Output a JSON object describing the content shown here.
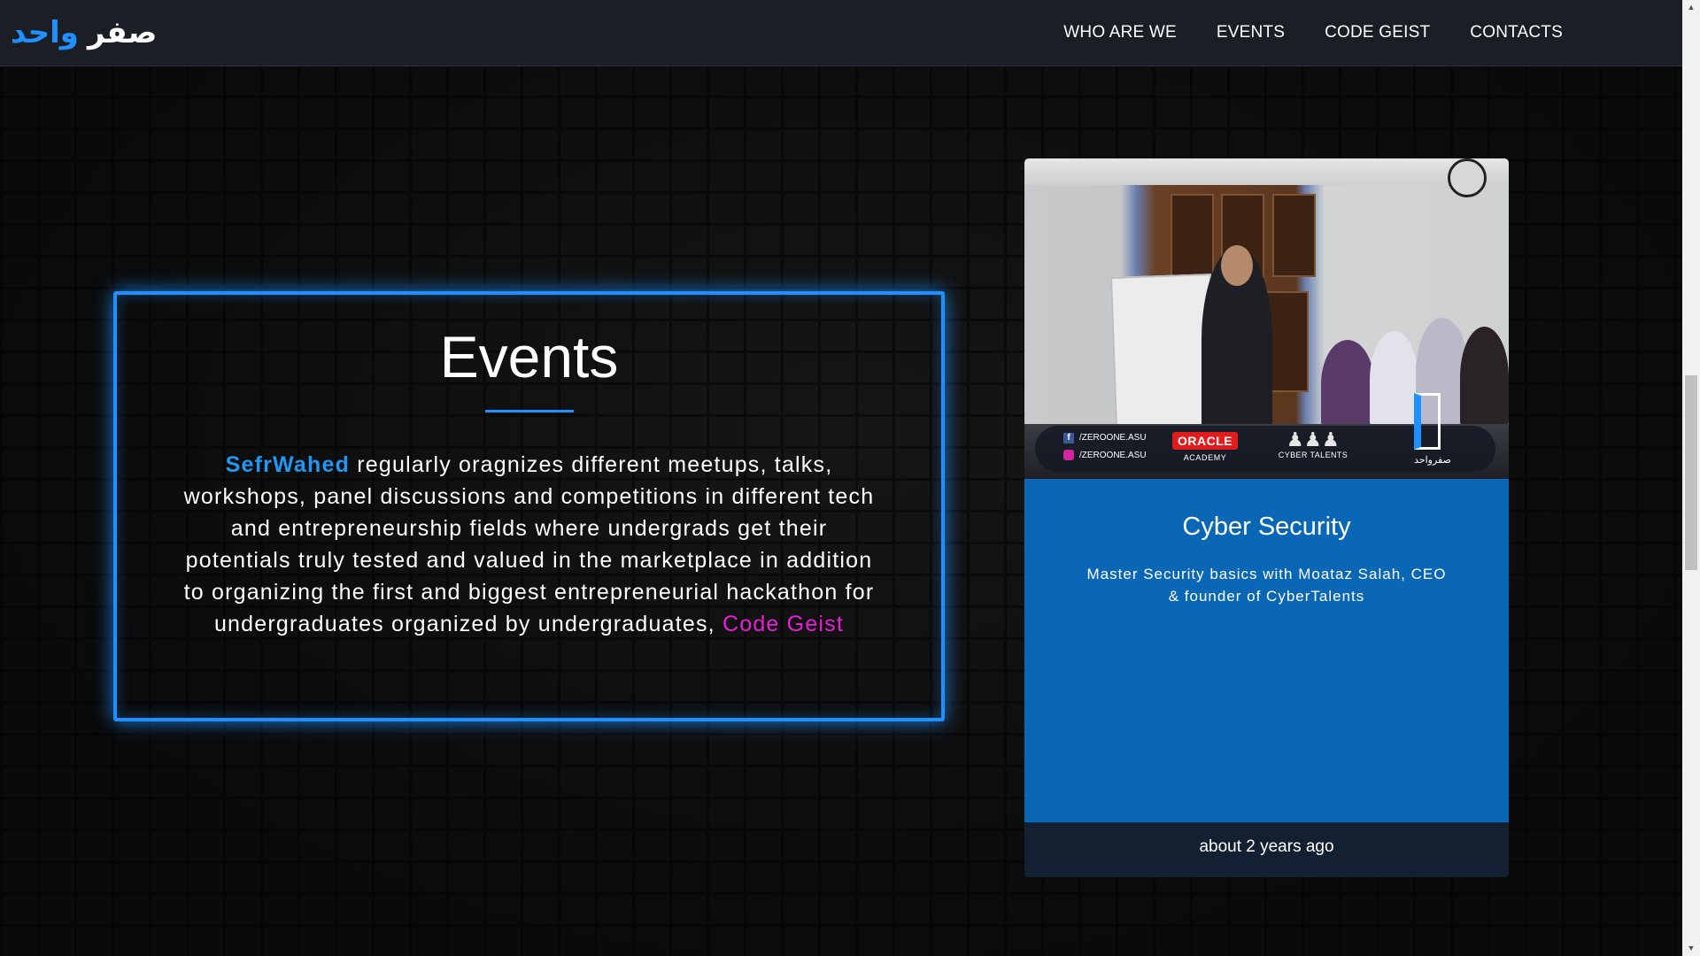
{
  "brand": {
    "word1": "صفر",
    "word2": "واحد"
  },
  "nav": {
    "items": [
      {
        "label": "WHO ARE WE"
      },
      {
        "label": "EVENTS"
      },
      {
        "label": "CODE GEIST"
      },
      {
        "label": "CONTACTS"
      }
    ]
  },
  "events": {
    "title": "Events",
    "org_name": "SefrWahed",
    "description": "regularly oragnizes different meetups, talks, workshops, panel discussions and competitions in different tech and entrepreneurship fields where undergrads get their potentials truly tested and valued in the marketplace in addition to organizing the first and biggest entrepreneurial hackathon for undergraduates organized by undergraduates,",
    "highlight": "Code Geist"
  },
  "card": {
    "image": {
      "social_fb": "/ZEROONE.ASU",
      "social_ig": "/ZEROONE.ASU",
      "oracle_logo": "ORACLE",
      "oracle_sub": "ACADEMY",
      "cyber_logo": "CYBER TALENTS",
      "logo_text": "صفرواحد"
    },
    "title": "Cyber Security",
    "description": "Master Security basics with Moataz Salah, CEO & founder of CyberTalents",
    "footer": "about 2 years ago"
  },
  "colors": {
    "accent": "#1e90ff",
    "highlight": "#e91ed6",
    "card_bg": "#0a67b5",
    "navbar_bg": "#1b1e24"
  }
}
